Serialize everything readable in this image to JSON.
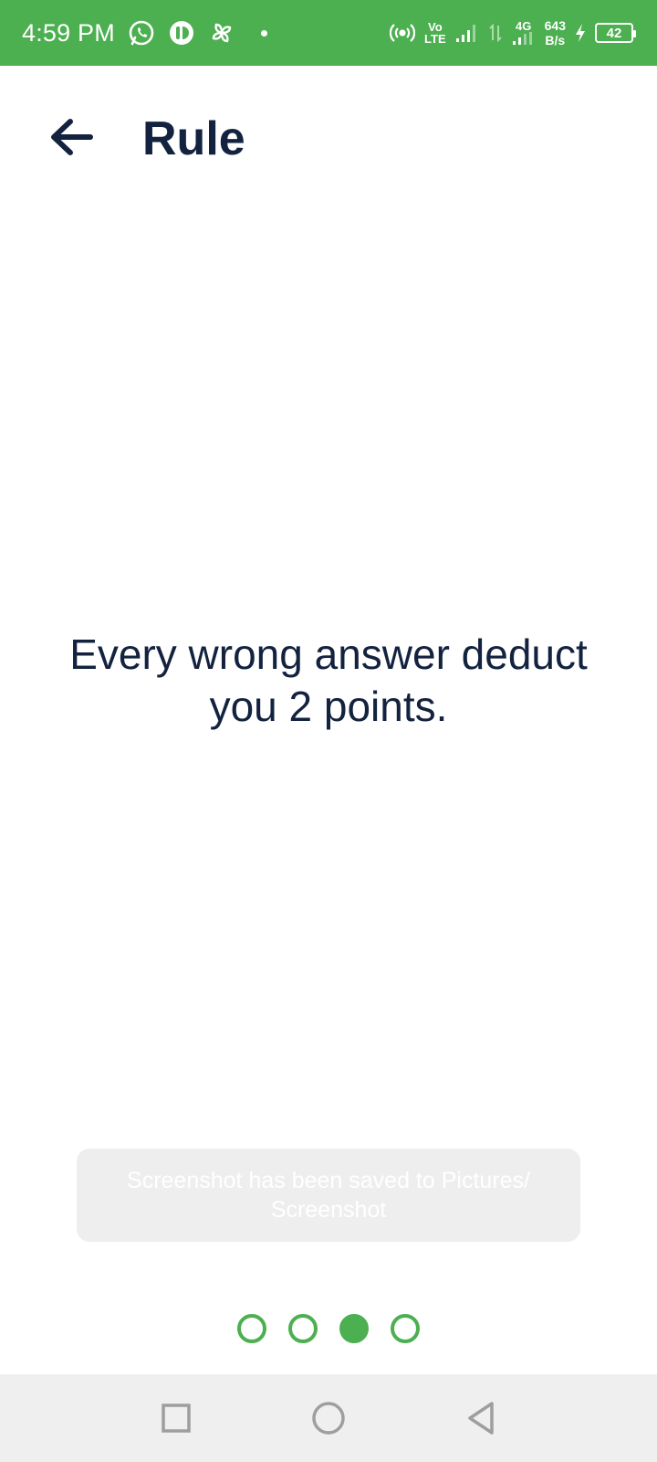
{
  "status_bar": {
    "time": "4:59 PM",
    "icons_left": [
      "whatsapp-icon",
      "app-notification-icon",
      "pinwheel-icon",
      "more-notifications-dot"
    ],
    "vo_lte_top": "Vo",
    "vo_lte_bottom": "LTE",
    "network_label": "4G",
    "speed_value": "643",
    "speed_unit": "B/s",
    "battery": "42",
    "color": "#4caf50"
  },
  "app_bar": {
    "back_icon": "arrow-left-icon",
    "title": "Rule",
    "title_color": "#13233f"
  },
  "main": {
    "rule_text": "Every wrong answer deduct you 2 points."
  },
  "toast": {
    "message": "Screenshot has been saved to  Pictures/ Screenshot"
  },
  "page_indicator": {
    "total": 4,
    "active_index": 2,
    "accent": "#4caf50"
  },
  "nav_bar": {
    "buttons": [
      "recent-apps-icon",
      "home-icon",
      "back-triangle-icon"
    ]
  }
}
